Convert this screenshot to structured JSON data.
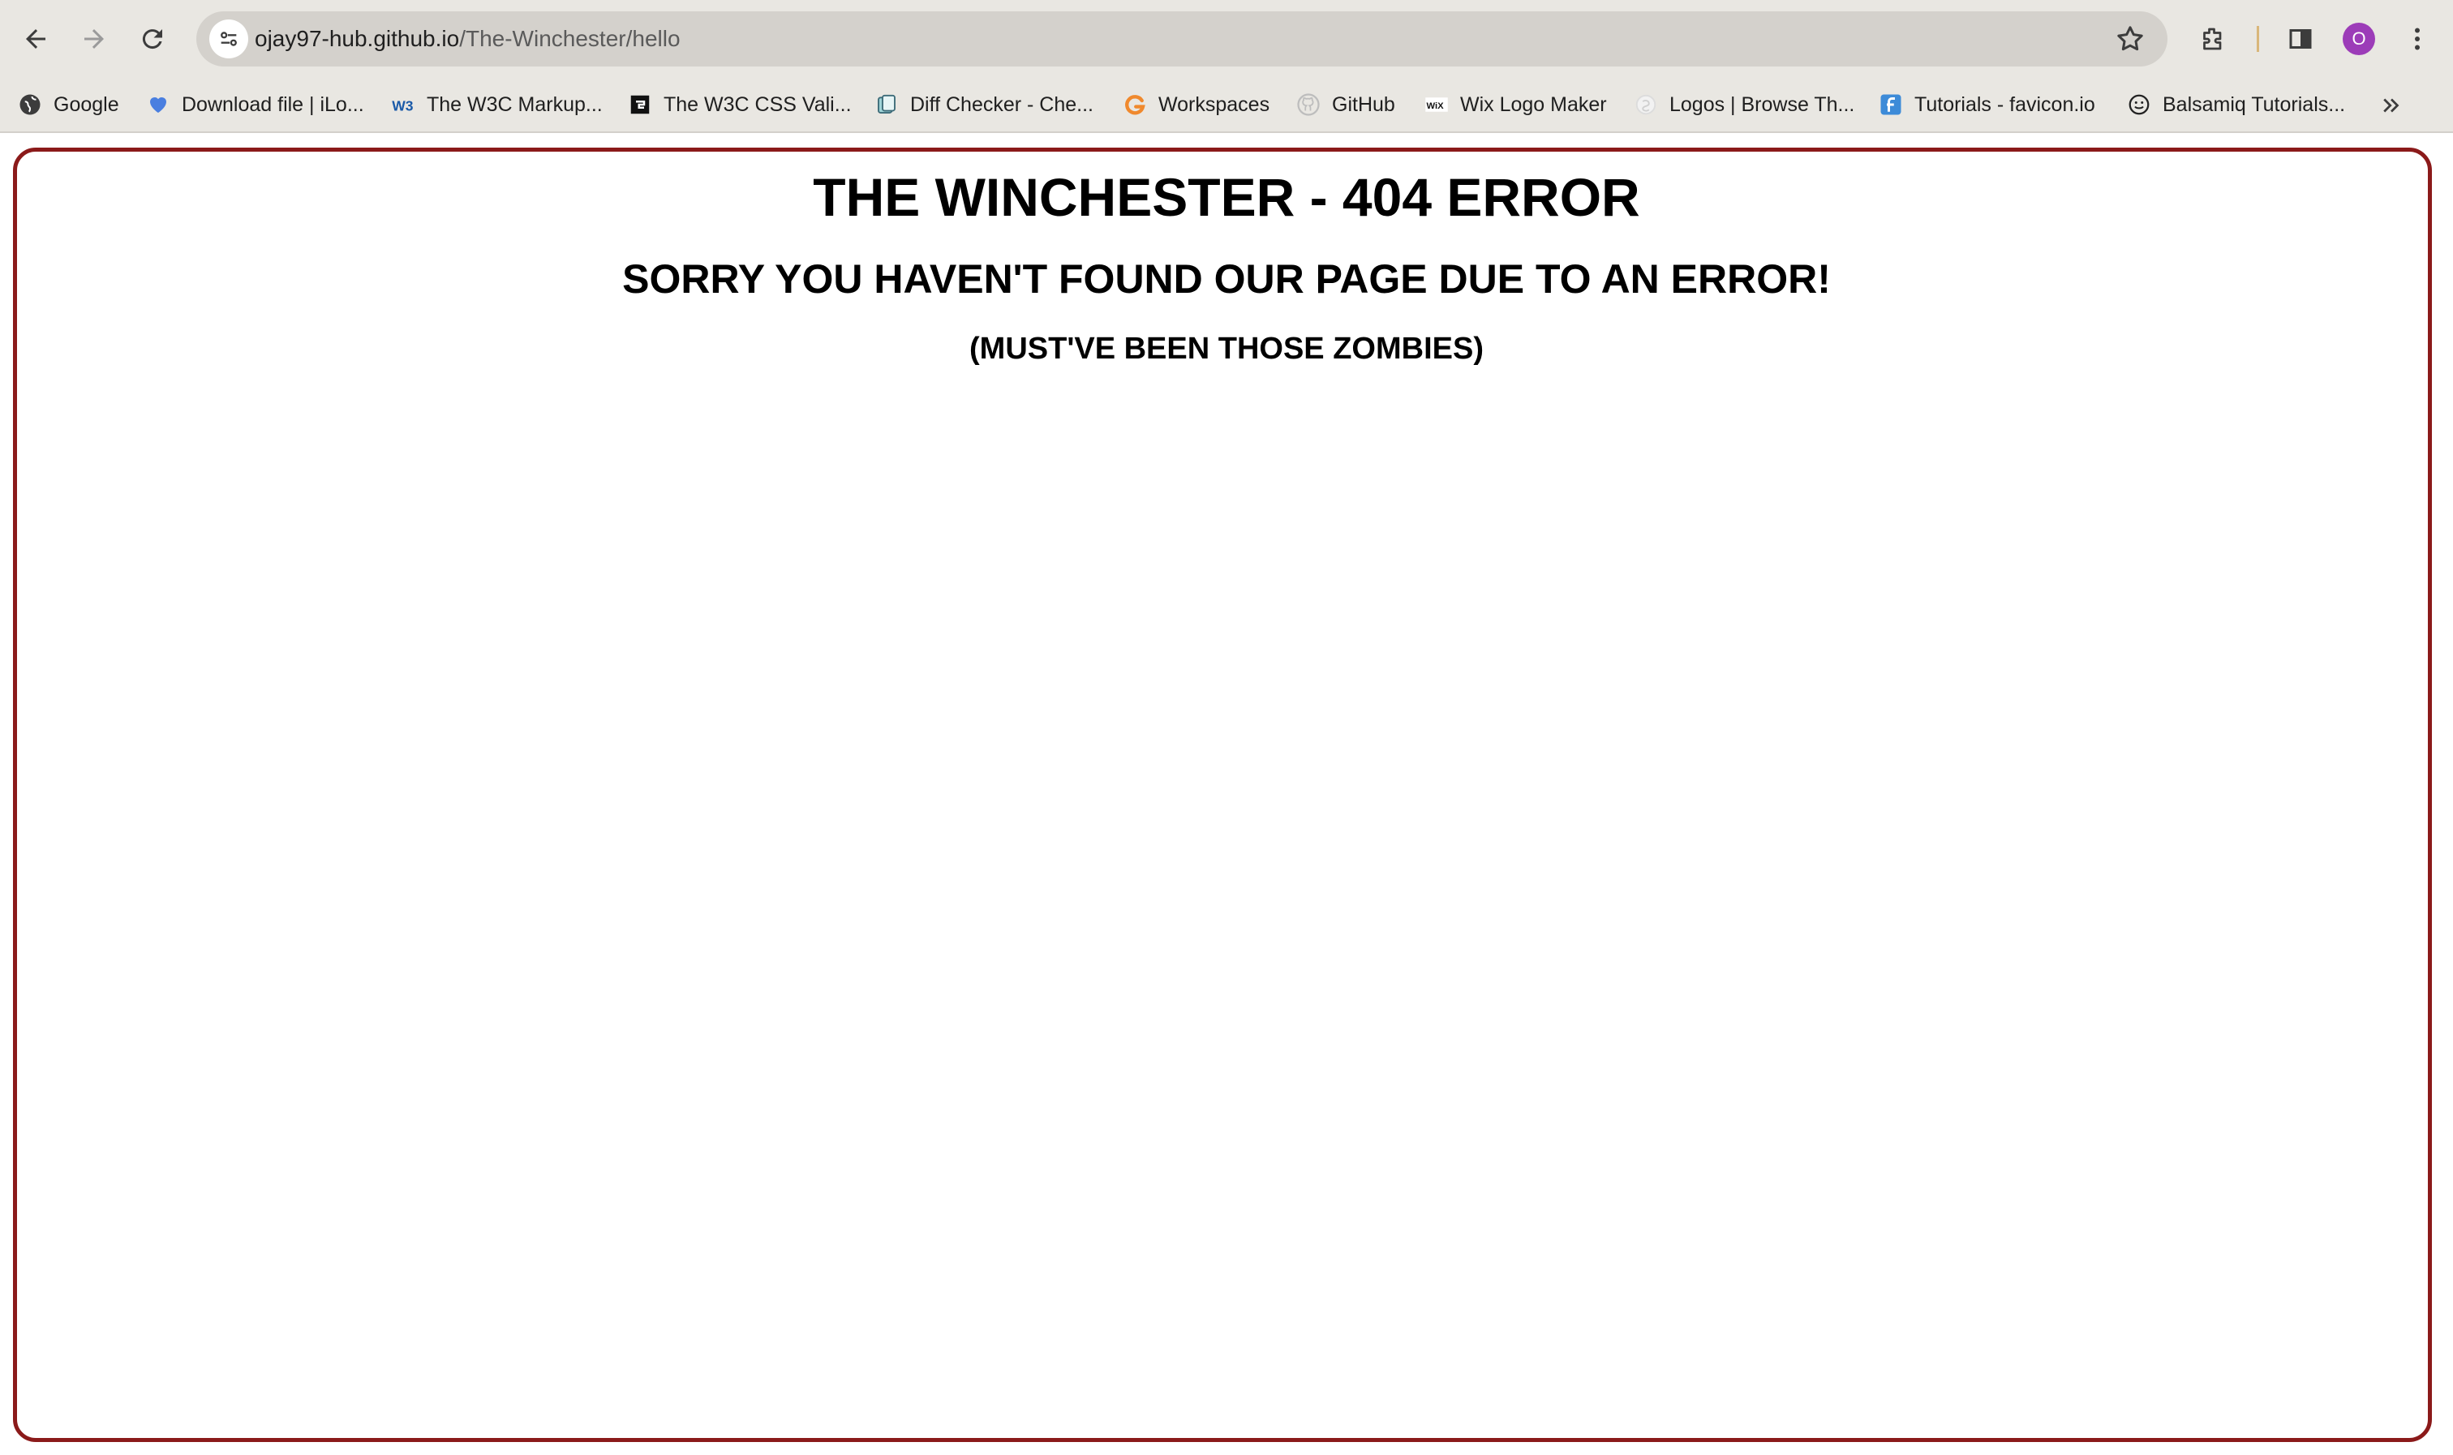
{
  "browser": {
    "url_host": "ojay97-hub.github.io",
    "url_path": "/The-Winchester/hello",
    "profile_initial": "O",
    "accent_color": "#8b1a1a",
    "avatar_color": "#9c3cb8"
  },
  "toolbar": {
    "icons": [
      "back-icon",
      "forward-icon",
      "reload-icon",
      "site-settings-icon",
      "bookmark-star-icon",
      "extensions-icon",
      "side-panel-icon",
      "more-menu-icon"
    ]
  },
  "bookmarks": [
    {
      "label": "Google",
      "icon": "globe-icon"
    },
    {
      "label": "Download file | iLo...",
      "icon": "heart-icon"
    },
    {
      "label": "The W3C Markup...",
      "icon": "w3c-icon"
    },
    {
      "label": "The W3C CSS Vali...",
      "icon": "w3c-css-icon"
    },
    {
      "label": "Diff Checker - Che...",
      "icon": "diffchecker-icon"
    },
    {
      "label": "Workspaces",
      "icon": "workspaces-icon"
    },
    {
      "label": "GitHub",
      "icon": "github-icon"
    },
    {
      "label": "Wix Logo Maker",
      "icon": "wix-icon"
    },
    {
      "label": "Logos | Browse Th...",
      "icon": "logos-icon"
    },
    {
      "label": "Tutorials - favicon.io",
      "icon": "favicon-icon"
    },
    {
      "label": "Balsamiq Tutorials...",
      "icon": "balsamiq-icon"
    }
  ],
  "page": {
    "title": "THE WINCHESTER - 404 ERROR",
    "subtitle": "SORRY YOU HAVEN'T FOUND OUR PAGE DUE TO AN ERROR!",
    "note": "(MUST'VE BEEN THOSE ZOMBIES)"
  }
}
